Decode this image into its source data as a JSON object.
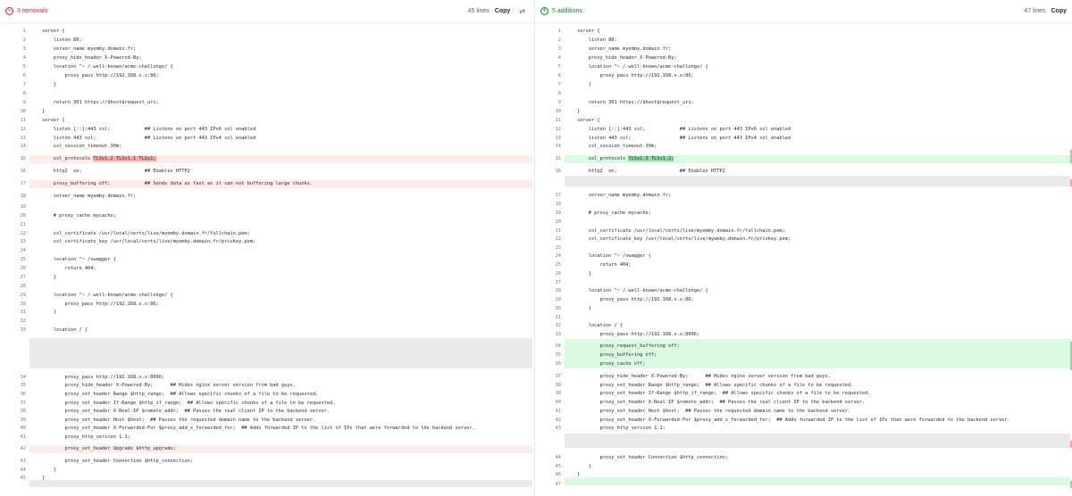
{
  "left": {
    "title": "3 removals",
    "lines_label": "45 lines",
    "copy_label": "Copy",
    "swap_icon": "⇄",
    "lines": [
      {
        "n": "1",
        "t": "server {"
      },
      {
        "n": "2",
        "t": "    listen 80;"
      },
      {
        "n": "3",
        "t": "    server_name myemby.domain.fr;"
      },
      {
        "n": "4",
        "t": "    proxy_hide_header X-Powered-By;"
      },
      {
        "n": "5",
        "t": "    location ^~ /.well-known/acme-challenge/ {"
      },
      {
        "n": "6",
        "t": "        proxy_pass http://192.168.x.x:86;"
      },
      {
        "n": "7",
        "t": "    }"
      },
      {
        "n": "8",
        "t": ""
      },
      {
        "n": "9",
        "t": "    return 301 https://$host$request_uri;"
      },
      {
        "n": "10",
        "t": "}"
      },
      {
        "n": "11",
        "t": "server {"
      },
      {
        "n": "12",
        "t": "    listen [::]:443 ssl;            ## Listens on port 443 IPv6 ssl enabled"
      },
      {
        "n": "13",
        "t": "    listen 443 ssl;                 ## Listens on port 443 IPv4 ssl enabled"
      },
      {
        "n": "14",
        "t": "    ssl_session_timeout 30m;"
      },
      {
        "n": "15",
        "t": "    ssl_protocols ",
        "hl": "TLSv1.2 TLSv1.1 TLSv1;"
      },
      {
        "n": "16",
        "t": "    http2  on;                      ## Enables HTTP2"
      },
      {
        "n": "17",
        "t": "    proxy_buffering off;            ## Sends data as fast as it can not buffering large chunks."
      },
      {
        "n": "18",
        "t": "    server_name myemby.domain.fr;"
      },
      {
        "n": "19",
        "t": ""
      },
      {
        "n": "20",
        "t": "    # proxy_cache mycache;"
      },
      {
        "n": "21",
        "t": ""
      },
      {
        "n": "22",
        "t": "    ssl_certificate /usr/local/certs/live/myemby.domain.fr/fullchain.pem;"
      },
      {
        "n": "23",
        "t": "    ssl_certificate_key /usr/local/certs/live/myemby.domain.fr/privkey.pem;"
      },
      {
        "n": "24",
        "t": ""
      },
      {
        "n": "25",
        "t": "    location ^~ /swagger {"
      },
      {
        "n": "26",
        "t": "        return 404;"
      },
      {
        "n": "27",
        "t": "    }"
      },
      {
        "n": "28",
        "t": ""
      },
      {
        "n": "29",
        "t": "    location ^~ /.well-known/acme-challenge/ {"
      },
      {
        "n": "30",
        "t": "        proxy_pass http://192.168.x.x:86;"
      },
      {
        "n": "31",
        "t": "    }"
      },
      {
        "n": "32",
        "t": ""
      },
      {
        "n": "33",
        "t": "    location / {"
      },
      {
        "n": "34",
        "t": "        proxy_pass http://192.168.x.x:8096;"
      },
      {
        "n": "35",
        "t": "        proxy_hide_header X-Powered-By;      ## Hides nginx server version from bad guys."
      },
      {
        "n": "36",
        "t": "        proxy_set_header Range $http_range;  ## Allows specific chunks of a file to be requested."
      },
      {
        "n": "37",
        "t": "        proxy_set_header If-Range $http_if_range;  ## Allows specific chunks of a file to be requested."
      },
      {
        "n": "38",
        "t": "        proxy_set_header X-Real-IP $remote_addr;  ## Passes the real client IP to the backend server."
      },
      {
        "n": "39",
        "t": "        proxy_set_header Host $host;  ## Passes the requested domain name to the backend server."
      },
      {
        "n": "40",
        "t": "        proxy_set_header X-Forwarded-For $proxy_add_x_forwarded_for;  ## Adds forwarded IP to the list of IPs that were forwarded to the backend server."
      },
      {
        "n": "41",
        "t": "        proxy_http_version 1.1;"
      },
      {
        "n": "42",
        "t": "        proxy_set_header Upgrade $http_upgrade;"
      },
      {
        "n": "43",
        "t": "        proxy_set_header Connection $http_connection;"
      },
      {
        "n": "44",
        "t": "    }"
      },
      {
        "n": "45",
        "t": "}"
      }
    ]
  },
  "right": {
    "title": "5 additions",
    "lines_label": "47 lines",
    "copy_label": "Copy",
    "lines": [
      {
        "n": "1",
        "t": "server {"
      },
      {
        "n": "2",
        "t": "    listen 80;"
      },
      {
        "n": "3",
        "t": "    server_name myemby.domain.fr;"
      },
      {
        "n": "4",
        "t": "    proxy_hide_header X-Powered-By;"
      },
      {
        "n": "5",
        "t": "    location ^~ /.well-known/acme-challenge/ {"
      },
      {
        "n": "6",
        "t": "        proxy_pass http://192.168.x.x:86;"
      },
      {
        "n": "7",
        "t": "    }"
      },
      {
        "n": "8",
        "t": ""
      },
      {
        "n": "9",
        "t": "    return 301 https://$host$request_uri;"
      },
      {
        "n": "10",
        "t": "}"
      },
      {
        "n": "11",
        "t": "server {"
      },
      {
        "n": "12",
        "t": "    listen [::]:443 ssl;            ## Listens on port 443 IPv6 ssl enabled"
      },
      {
        "n": "13",
        "t": "    listen 443 ssl;                 ## Listens on port 443 IPv4 ssl enabled"
      },
      {
        "n": "14",
        "t": "    ssl_session_timeout 30m;"
      },
      {
        "n": "15",
        "t": "    ssl_protocols ",
        "hl": "TLSv1.3 TLSv1.2;"
      },
      {
        "n": "16",
        "t": "    http2  on;                      ## Enables HTTP2"
      },
      {
        "n": "17",
        "t": "    server_name myemby.domain.fr;"
      },
      {
        "n": "18",
        "t": ""
      },
      {
        "n": "19",
        "t": "    # proxy_cache mycache;"
      },
      {
        "n": "20",
        "t": ""
      },
      {
        "n": "21",
        "t": "    ssl_certificate /usr/local/certs/live/myemby.domain.fr/fullchain.pem;"
      },
      {
        "n": "22",
        "t": "    ssl_certificate_key /usr/local/certs/live/myemby.domain.fr/privkey.pem;"
      },
      {
        "n": "23",
        "t": ""
      },
      {
        "n": "24",
        "t": "    location ^~ /swagger {"
      },
      {
        "n": "25",
        "t": "        return 404;"
      },
      {
        "n": "26",
        "t": "    }"
      },
      {
        "n": "27",
        "t": ""
      },
      {
        "n": "28",
        "t": "    location ^~ /.well-known/acme-challenge/ {"
      },
      {
        "n": "29",
        "t": "        proxy_pass http://192.168.x.x:86;"
      },
      {
        "n": "30",
        "t": "    }"
      },
      {
        "n": "31",
        "t": ""
      },
      {
        "n": "32",
        "t": "    location / {"
      },
      {
        "n": "33",
        "t": "        proxy_pass http://192.168.x.x:8096;"
      },
      {
        "n": "34",
        "t": "        proxy_request_buffering off;"
      },
      {
        "n": "35",
        "t": "        proxy_buffering off;"
      },
      {
        "n": "36",
        "t": "        proxy_cache off;"
      },
      {
        "n": "37",
        "t": "        proxy_hide_header X-Powered-By;      ## Hides nginx server version from bad guys."
      },
      {
        "n": "38",
        "t": "        proxy_set_header Range $http_range;  ## Allows specific chunks of a file to be requested."
      },
      {
        "n": "39",
        "t": "        proxy_set_header If-Range $http_if_range;  ## Allows specific chunks of a file to be requested."
      },
      {
        "n": "40",
        "t": "        proxy_set_header X-Real-IP $remote_addr;  ## Passes the real client IP to the backend server."
      },
      {
        "n": "41",
        "t": "        proxy_set_header Host $host;  ## Passes the requested domain name to the backend server."
      },
      {
        "n": "42",
        "t": "        proxy_set_header X-Forwarded-For $proxy_add_x_forwarded_for;  ## Adds forwarded IP to the list of IPs that were forwarded to the backend server."
      },
      {
        "n": "43",
        "t": "        proxy_http_version 1.1;"
      },
      {
        "n": "44",
        "t": "        proxy_set_header Connection $http_connection;"
      },
      {
        "n": "45",
        "t": "    }"
      },
      {
        "n": "46",
        "t": "}"
      },
      {
        "n": "47",
        "t": ""
      }
    ]
  },
  "colors": {
    "removal": "#cf222e",
    "addition": "#1a7f37",
    "removed_line_bg": "#ffebe9",
    "added_line_bg": "#dafbe1"
  }
}
